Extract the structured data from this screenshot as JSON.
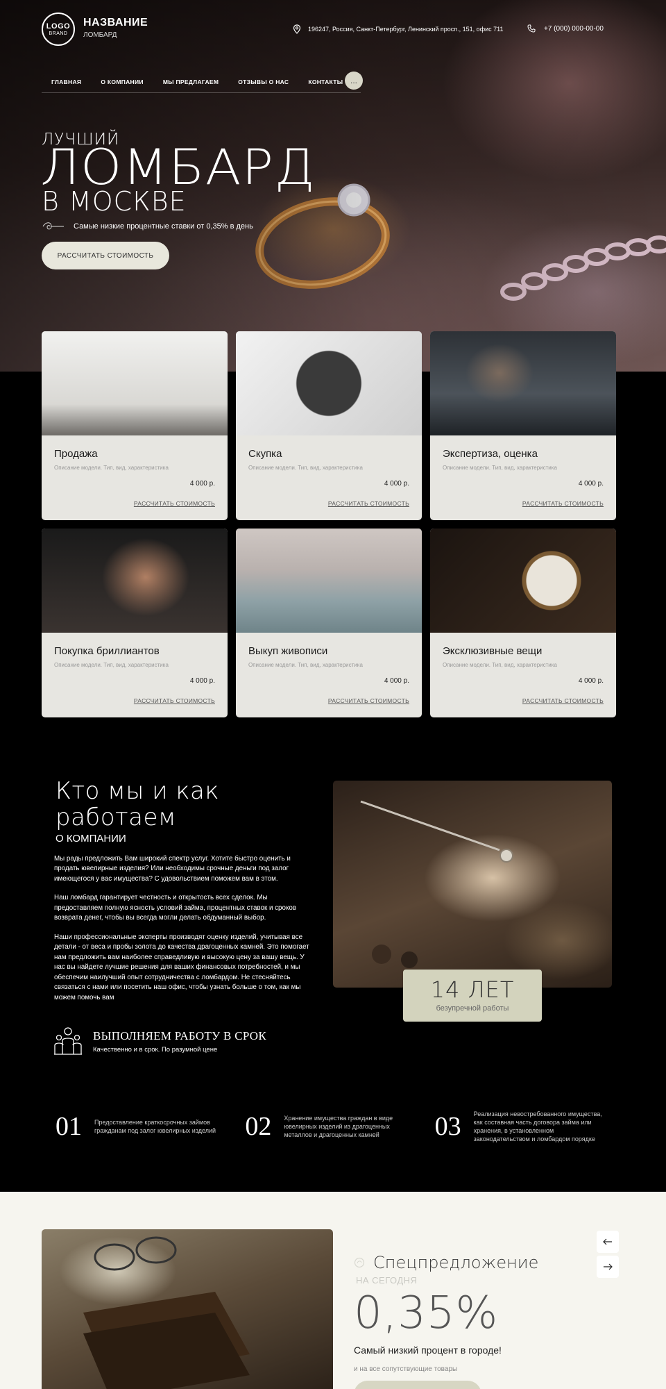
{
  "header": {
    "logo_line1": "LOGO",
    "logo_line2": "BRAND",
    "brand_name": "НАЗВАНИЕ",
    "brand_sub": "ЛОМБАРД",
    "address": "196247, Россия, Санкт-Петербург, Ленинский просп., 151, офис 711",
    "phone": "+7 (000) 000-00-00",
    "nav": [
      "ГЛАВНАЯ",
      "О КОМПАНИИ",
      "МЫ ПРЕДЛАГАЕМ",
      "ОТЗЫВЫ О НАС",
      "КОНТАКТЫ"
    ],
    "nav_more": "..."
  },
  "hero": {
    "pre": "ЛУЧШИЙ",
    "title": "ЛОМБАРД",
    "city": "В МОСКВЕ",
    "rate_text": "Самые низкие процентные ставки от 0,35% в день",
    "button": "РАССЧИТАТЬ СТОИМОСТЬ"
  },
  "cards": [
    {
      "title": "Продажа",
      "desc": "Описание модели. Тип, вид, характеристика",
      "price": "4 000 р.",
      "link": "РАССЧИТАТЬ СТОИМОСТЬ"
    },
    {
      "title": "Скупка",
      "desc": "Описание модели. Тип, вид, характеристика",
      "price": "4 000 р.",
      "link": "РАССЧИТАТЬ СТОИМОСТЬ"
    },
    {
      "title": "Экспертиза, оценка",
      "desc": "Описание модели. Тип, вид, характеристика",
      "price": "4 000 р.",
      "link": "РАССЧИТАТЬ СТОИМОСТЬ"
    },
    {
      "title": "Покупка бриллиантов",
      "desc": "Описание модели. Тип, вид, характеристика",
      "price": "4 000 р.",
      "link": "РАССЧИТАТЬ СТОИМОСТЬ"
    },
    {
      "title": "Выкуп живописи",
      "desc": "Описание модели. Тип, вид, характеристика",
      "price": "4 000 р.",
      "link": "РАССЧИТАТЬ СТОИМОСТЬ"
    },
    {
      "title": "Эксклюзивные вещи",
      "desc": "Описание модели. Тип, вид, характеристика",
      "price": "4 000 р.",
      "link": "РАССЧИТАТЬ СТОИМОСТЬ"
    }
  ],
  "about": {
    "title": "Кто мы и как работаем",
    "sub": "О КОМПАНИИ",
    "paragraphs": [
      "Мы рады предложить Вам широкий спектр услуг. Хотите быстро оценить и продать ювелирные изделия? Или необходимы срочные деньги под залог имеющегося у вас имущества? С удовольствием поможем вам в этом.",
      "Наш ломбард гарантирует честность и открытость всех сделок. Мы предоставляем полную ясность условий займа, процентных ставок и сроков возврата денег, чтобы вы всегда могли делать обдуманный выбор.",
      "Наши профессиональные эксперты производят оценку изделий, учитывая все детали - от веса и пробы золота до качества драгоценных камней. Это помогает нам предложить вам наиболее справедливую и высокую цену за вашу вещь. У нас вы найдете лучшие решения для ваших финансовых потребностей, и мы обеспечим наилучший опыт сотрудничества с ломбардом. Не стесняйтесь связаться с нами или посетить наш офис, чтобы узнать больше о том, как мы можем помочь вам"
    ],
    "years_number": "14 ЛЕТ",
    "years_text": "безупречной работы",
    "deadline_title": "ВЫПОЛНЯЕМ РАБОТУ В СРОК",
    "deadline_text": "Качественно и в срок. По разумной цене"
  },
  "steps": [
    {
      "num": "01",
      "text": "Предоставление краткосрочных займов гражданам под залог ювелирных изделий"
    },
    {
      "num": "02",
      "text": "Хранение имущества граждан в виде ювелирных изделий из драгоценных металлов и драгоценных камней"
    },
    {
      "num": "03",
      "text": "Реализация невостребованного имущества, как составная часть договора займа или хранения, в установленном законодательством и ломбардом порядке"
    }
  ],
  "offer": {
    "title": "Спецпредложение",
    "sub": "НА СЕГОДНЯ",
    "rate": "0,35%",
    "lead": "Самый низкий процент в городе!",
    "note": "и на все сопутствующие товары"
  }
}
